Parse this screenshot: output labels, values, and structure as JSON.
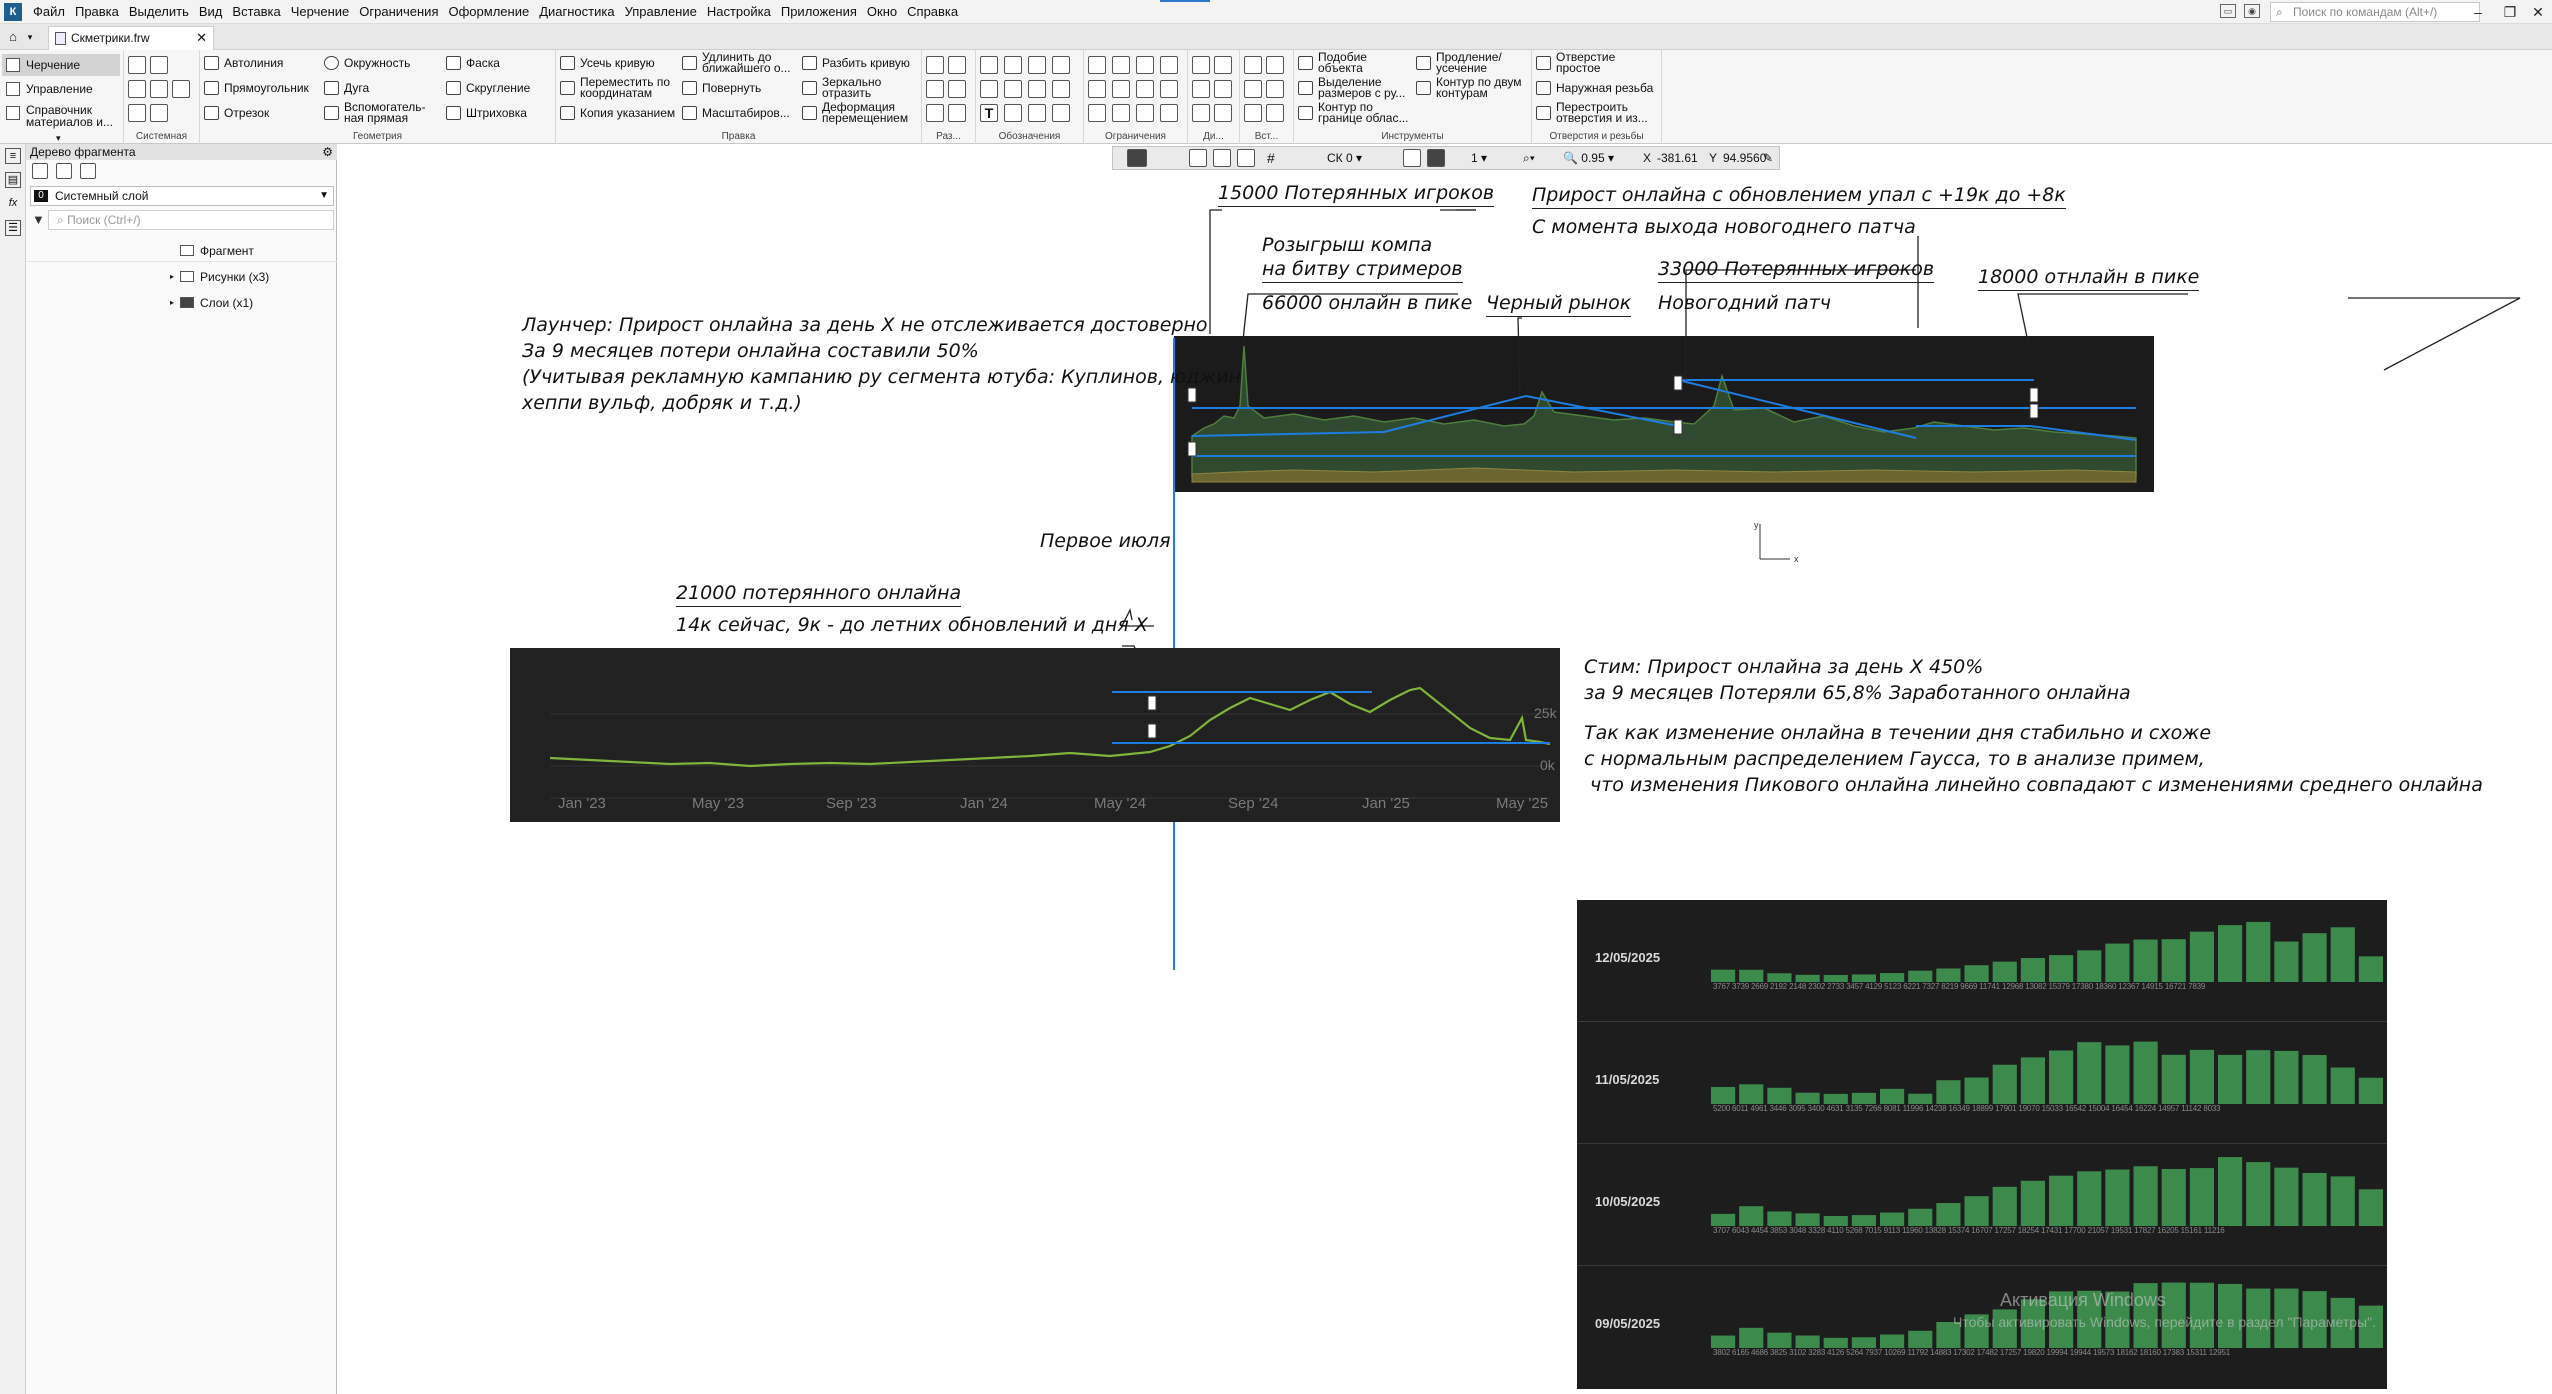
{
  "menubar": {
    "app_letter": "К",
    "items": [
      "Файл",
      "Правка",
      "Выделить",
      "Вид",
      "Вставка",
      "Черчение",
      "Ограничения",
      "Оформление",
      "Диагностика",
      "Управление",
      "Настройка",
      "Приложения",
      "Окно",
      "Справка"
    ],
    "search_placeholder": "Поиск по командам (Alt+/)"
  },
  "tabs": {
    "document": "Скметрики.frw"
  },
  "ribbon": {
    "modes": [
      "Черчение",
      "Управление",
      "Справочник материалов и..."
    ],
    "groups": {
      "system": "Системная",
      "geometry": "Геометрия",
      "edit": "Правка",
      "size": "Раз...",
      "notation": "Обозначения",
      "constraints": "Ограничения",
      "di": "Ди...",
      "vst": "Вст...",
      "tools": "Инструменты",
      "holes": "Отверстия и резьбы"
    },
    "geometry": [
      "Автолиния",
      "Окружность",
      "Фаска",
      "Прямоугольник",
      "Дуга",
      "Скругление",
      "Отрезок",
      "Вспомогатель-ная прямая",
      "Штриховка"
    ],
    "edit": [
      "Усечь кривую",
      "Удлинить до ближайшего о...",
      "Разбить кривую",
      "Переместить по координатам",
      "Повернуть",
      "Зеркально отразить",
      "Копия указанием",
      "Масштабиров...",
      "Деформация перемещением"
    ],
    "tools": [
      "Подобие объекта",
      "Продление/ усечение",
      "Выделение размеров с ру...",
      "Контур по двум контурам",
      "Контур по границе облас..."
    ],
    "holes": [
      "Отверстие простое",
      "Наружная резьба",
      "Перестроить отверстия и из..."
    ]
  },
  "panel": {
    "title": "Дерево фрагмента",
    "layer_num": "0",
    "layer": "Системный слой",
    "search_placeholder": "Поиск (Ctrl+/)",
    "tree": [
      "Фрагмент",
      "Рисунки (x3)",
      "Слои (x1)"
    ]
  },
  "status": {
    "cs": "СК 0",
    "step": "1",
    "zoom": "0.95",
    "x_label": "X",
    "x": "-381.61",
    "y_label": "Y",
    "y": "94.9560"
  },
  "annotations": {
    "lost_15000": "15000 Потерянных игроков",
    "giveaway_1": "Розыгрыш компа",
    "giveaway_2": "на битву стримеров",
    "peak_66000": "66000 онлайн в пике",
    "black_market": "Черный рынок",
    "patch_drop_1": "Прирост онлайна с обновлением упал с +19к до +8к",
    "patch_drop_2": "С момента выхода новогоднего патча",
    "lost_33000": "33000 Потерянных игроков",
    "new_year_patch": "Новогодний патч",
    "peak_18000": "18000 отнлайн в пике",
    "launcher_1": "Лаунчер: Прирост онлайна за день X не отслеживается достоверно",
    "launcher_2": "За 9 месяцев потери онлайна составили 50%",
    "launcher_3": "(Учитывая рекламную кампанию ру сегмента ютуба: Куплинов, юджин",
    "launcher_4": "хеппи вульф, добряк и т.д.)",
    "first_july": "Первое июля",
    "lost_21000": "21000 потерянного онлайна",
    "now_14k": "14к сейчас, 9к - до летних обновлений и дня X",
    "steam_1": "Стим: Прирост онлайна за день X 450%",
    "steam_2": "за 9 месяцев Потеряли 65,8% Заработанного онлайна",
    "gauss_1": "Так как изменение онлайна в течении дня стабильно и схоже",
    "gauss_2": "с нормальным распределением Гаусса, то в анализе примем,",
    "gauss_3": "что изменения Пикового онлайна линейно совпадают с изменениями среднего онлайна"
  },
  "axis_glyphs": {
    "x": "x",
    "y": "y"
  },
  "chart_data": [
    {
      "type": "area",
      "title": "",
      "series": [],
      "note_points": {
        "peak": 66000
      }
    },
    {
      "type": "line",
      "title": "",
      "categories": [
        "Jan '23",
        "May '23",
        "Sep '23",
        "Jan '24",
        "May '24",
        "Sep '24",
        "Jan '25",
        "May '25"
      ],
      "yticks": [
        "25k",
        "0k"
      ],
      "ylim": [
        0,
        25000
      ]
    },
    {
      "type": "bar",
      "rows": [
        {
          "date": "12/05/2025",
          "labels": "3767 3739 2669 2192 2148 2302 2733 3457 4129 5123 6221 7327 8219 9669 11741 12968 13082 15379 17380 18360 12367 14915 16721 7839"
        },
        {
          "date": "11/05/2025",
          "labels": "5200 6011 4961 3446 3095 3400 4631 3135 7266 8081 11996 14238 16349 18899 17901 19070 15033 16542 15004 16454 16224 14957 11142 8033"
        },
        {
          "date": "10/05/2025",
          "labels": "3707 6043 4454 3853 3048 3328 4110 5268 7015 9113 11960 13828 15374 16707 17257 18254 17431 17700 21057 19531 17827 16205 15161 11216"
        },
        {
          "date": "09/05/2025",
          "labels": "3802 6165 4686 3825 3102 3283 4126 5264 7937 10269 11792 14883 17302 17482 17257 19820 19994 19944 19573 18162 18160 17383 15311 12951"
        }
      ]
    }
  ],
  "watermark": {
    "title": "Активация Windows",
    "subtitle": "Чтобы активировать Windows, перейдите в раздел \"Параметры\"."
  },
  "colors": {
    "accent_blue": "#1e7de0",
    "chart_green": "#7fb53b",
    "bar_green": "#3d8a4d",
    "dark_bg": "#1b1b1b"
  }
}
